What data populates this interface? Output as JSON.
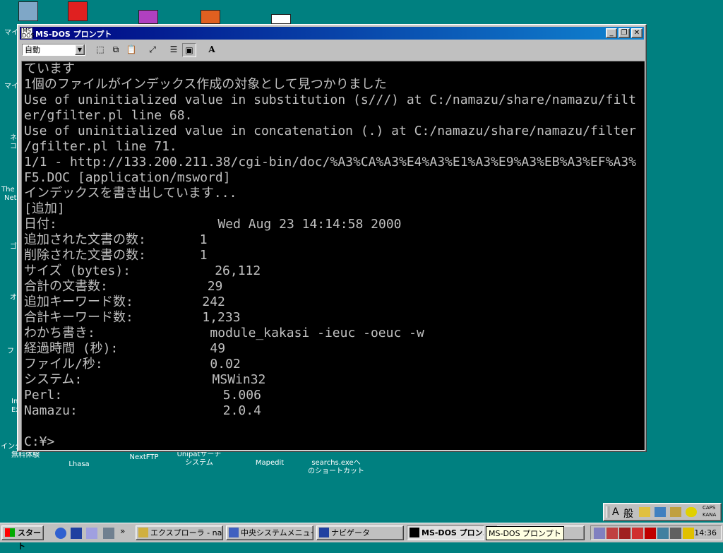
{
  "desktop": {
    "icons": [
      {
        "label": "NextFTP"
      },
      {
        "label": "Unipatサーチ\nシステム"
      },
      {
        "label": "Mapedit"
      },
      {
        "label": "searchs.exeへ\nのショートカット"
      },
      {
        "label": "Lhasa"
      },
      {
        "label": "インターネット\n無料体験"
      }
    ],
    "left_labels": [
      "マイ",
      "マイ",
      "ネ",
      "コ",
      "The",
      "Net",
      "ゴ",
      "オ",
      "フ",
      "In",
      "Ex"
    ]
  },
  "window": {
    "title": "MS-DOS プロンプト",
    "font_select": "自動",
    "console_lines": [
      "ています",
      "1個のファイルがインデックス作成の対象として見つかりました",
      "Use of uninitialized value in substitution (s///) at C:/namazu/share/namazu/filt",
      "er/gfilter.pl line 68.",
      "Use of uninitialized value in concatenation (.) at C:/namazu/share/namazu/filter",
      "/gfilter.pl line 71.",
      "1/1 - http://133.200.211.38/cgi-bin/doc/%A3%CA%A3%E4%A3%E1%A3%E9%A3%EB%A3%EF%A3%",
      "F5.DOC [application/msword]",
      "インデックスを書き出しています...",
      "[追加]",
      "日付:                     Wed Aug 23 14:14:58 2000",
      "追加された文書の数:       1",
      "削除された文書の数:       1",
      "サイズ (bytes):           26,112",
      "合計の文書数:             29",
      "追加キーワード数:         242",
      "合計キーワード数:         1,233",
      "わかち書き:               module_kakasi -ieuc -oeuc -w",
      "経過時間 (秒):            49",
      "ファイル/秒:              0.02",
      "システム:                 MSWin32",
      "Perl:                     5.006",
      "Namazu:                   2.0.4",
      "",
      "C:¥>"
    ]
  },
  "taskbar": {
    "start_label": "スタート",
    "tasks": [
      {
        "label": "エクスプローラ - na..."
      },
      {
        "label": "中央システムメニュー"
      },
      {
        "label": "ナビゲータ"
      },
      {
        "label": "MS-DOS プロン..."
      },
      {
        "label": "ト"
      }
    ],
    "tooltip": "MS-DOS プロンプト",
    "clock": "14:36",
    "ime_label": "般",
    "caps_label": "CAPS",
    "kana_label": "KANA"
  },
  "colors": {
    "desktop": "#008080",
    "title_start": "#000080",
    "title_end": "#1084d0",
    "console_bg": "#000000",
    "console_fg": "#c0c0c0"
  }
}
